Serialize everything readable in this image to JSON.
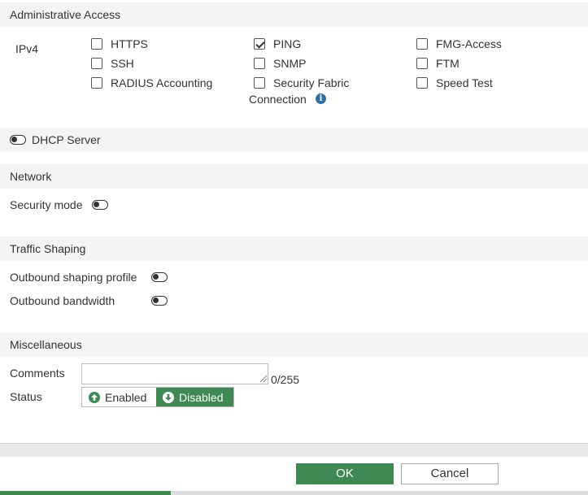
{
  "admin_access": {
    "header": "Administrative Access",
    "ipv4_label": "IPv4",
    "options": [
      {
        "label": "HTTPS",
        "checked": false
      },
      {
        "label": "SSH",
        "checked": false
      },
      {
        "label": "RADIUS Accounting",
        "checked": false
      },
      {
        "label": "PING",
        "checked": true
      },
      {
        "label": "SNMP",
        "checked": false
      },
      {
        "label": "Security Fabric",
        "label_cont": "Connection",
        "checked": false,
        "icon": "info-icon"
      },
      {
        "label": "FMG-Access",
        "checked": false
      },
      {
        "label": "FTM",
        "checked": false
      },
      {
        "label": "Speed Test",
        "checked": false
      }
    ]
  },
  "dhcp": {
    "label": "DHCP Server",
    "enabled": false
  },
  "network": {
    "header": "Network",
    "security_mode_label": "Security mode",
    "security_mode_enabled": false
  },
  "traffic_shaping": {
    "header": "Traffic Shaping",
    "outbound_profile_label": "Outbound shaping profile",
    "outbound_profile_enabled": false,
    "outbound_bandwidth_label": "Outbound bandwidth",
    "outbound_bandwidth_enabled": false
  },
  "misc": {
    "header": "Miscellaneous",
    "comments_label": "Comments",
    "comments_value": "",
    "comments_counter": "0/255",
    "status_label": "Status",
    "status_enabled_label": "Enabled",
    "status_disabled_label": "Disabled",
    "status_selected": "Disabled"
  },
  "footer": {
    "ok_label": "OK",
    "cancel_label": "Cancel",
    "progress": 0.29
  },
  "colors": {
    "accent": "#3f8a54",
    "info": "#2d6ea3",
    "header_bg": "#f4f4f4"
  }
}
